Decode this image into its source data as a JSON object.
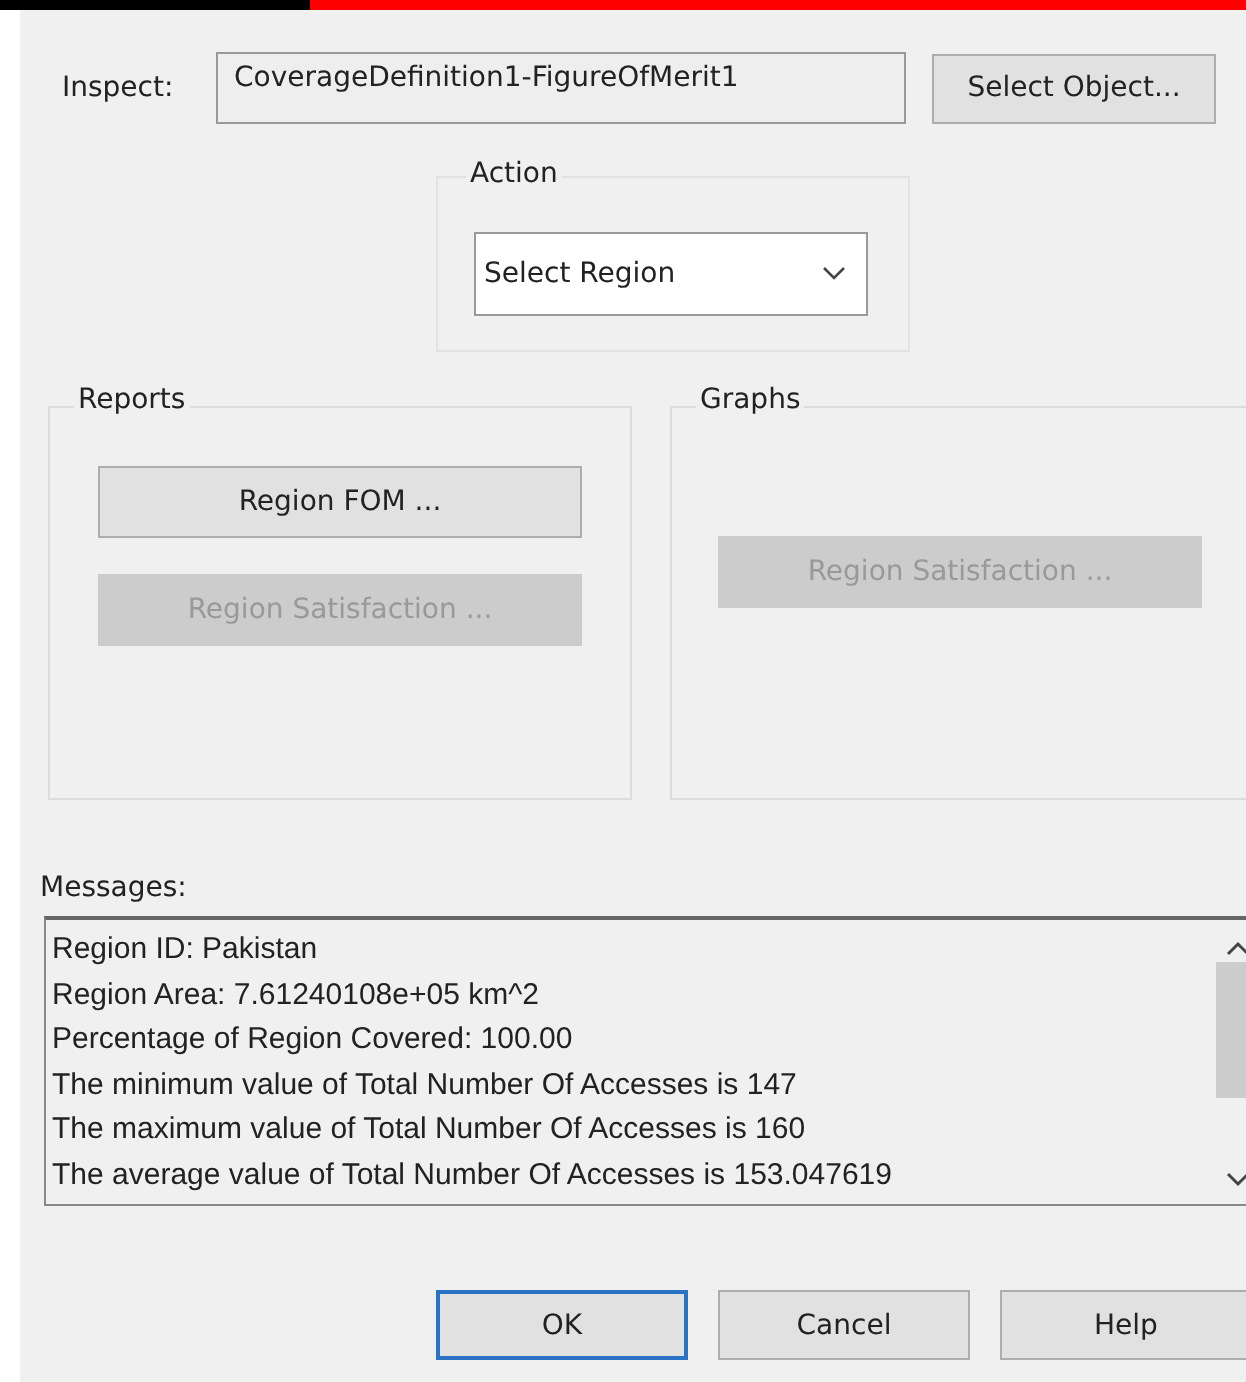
{
  "inspect": {
    "label": "Inspect:",
    "value": "CoverageDefinition1-FigureOfMerit1",
    "button": "Select Object..."
  },
  "action": {
    "title": "Action",
    "value": "Select Region"
  },
  "reports": {
    "title": "Reports",
    "buttons": [
      {
        "label": "Region FOM ...",
        "disabled": false
      },
      {
        "label": "Region Satisfaction ...",
        "disabled": true
      }
    ]
  },
  "graphs": {
    "title": "Graphs",
    "buttons": [
      {
        "label": "Region Satisfaction ...",
        "disabled": true
      }
    ]
  },
  "messages": {
    "label": "Messages:",
    "lines": [
      "Region ID: Pakistan",
      "Region Area: 7.61240108e+05 km^2",
      "Percentage of Region Covered: 100.00",
      "The minimum value of Total Number Of Accesses is 147",
      "The maximum value of Total Number Of Accesses is 160",
      "The average value of Total Number Of Accesses is 153.047619"
    ]
  },
  "buttons": [
    {
      "label": "OK",
      "selected": true
    },
    {
      "label": "Cancel",
      "selected": false
    },
    {
      "label": "Help",
      "selected": false
    }
  ]
}
